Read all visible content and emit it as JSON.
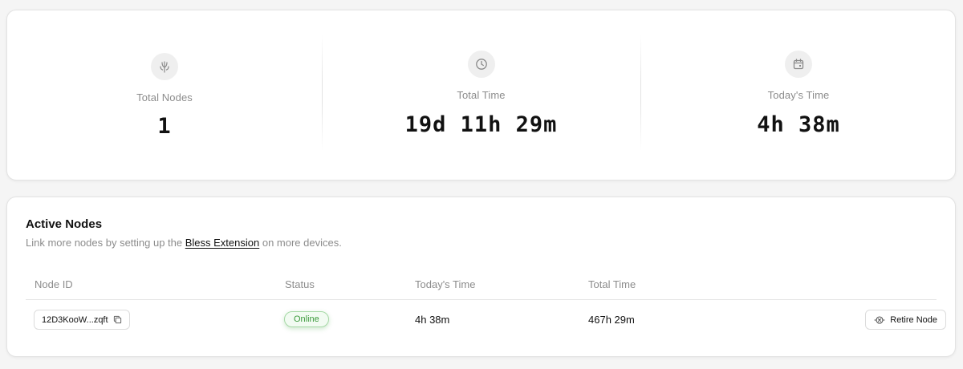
{
  "stats": {
    "total_nodes": {
      "icon": "nodes-icon",
      "label": "Total Nodes",
      "value": "1"
    },
    "total_time": {
      "icon": "clock-icon",
      "label": "Total Time",
      "value": "19d 11h 29m"
    },
    "todays_time": {
      "icon": "calendar-icon",
      "label": "Today's Time",
      "value": "4h 38m"
    }
  },
  "active_nodes": {
    "title": "Active Nodes",
    "subtitle_prefix": "Link more nodes by setting up the ",
    "subtitle_link": "Bless Extension",
    "subtitle_suffix": " on more devices.",
    "columns": {
      "node_id": "Node ID",
      "status": "Status",
      "todays_time": "Today's Time",
      "total_time": "Total Time"
    },
    "rows": [
      {
        "node_id": "12D3KooW...zqft",
        "status": "Online",
        "todays_time": "4h 38m",
        "total_time": "467h 29m",
        "action_label": "Retire Node"
      }
    ]
  },
  "colors": {
    "status_online": "#3c9a3c",
    "muted_text": "#8c8c8c"
  }
}
